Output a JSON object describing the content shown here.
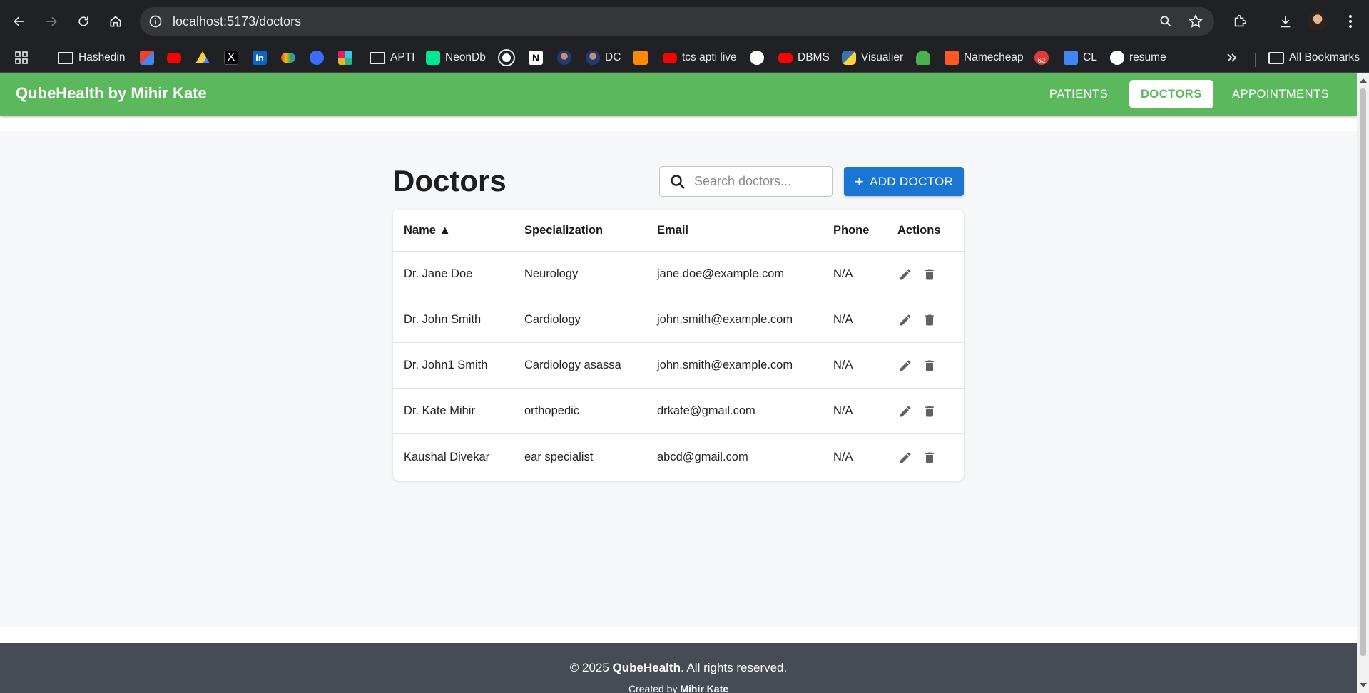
{
  "browser": {
    "url": "localhost:5173/doctors",
    "bookmarks": [
      {
        "label": "Hashedin",
        "icon": "folder-icon"
      },
      {
        "label": "",
        "icon": "gmail-icon"
      },
      {
        "label": "",
        "icon": "youtube-icon"
      },
      {
        "label": "",
        "icon": "google-drive-icon"
      },
      {
        "label": "",
        "icon": "x-icon"
      },
      {
        "label": "",
        "icon": "linkedin-icon"
      },
      {
        "label": "",
        "icon": "google-cloud-icon"
      },
      {
        "label": "",
        "icon": "kotak-icon"
      },
      {
        "label": "",
        "icon": "slack-icon"
      },
      {
        "label": "APTI",
        "icon": "folder-icon"
      },
      {
        "label": "NeonDb",
        "icon": "neon-icon"
      },
      {
        "label": "",
        "icon": "openai-icon"
      },
      {
        "label": "",
        "icon": "notion-icon"
      },
      {
        "label": "",
        "icon": "profile-icon"
      },
      {
        "label": "DC",
        "icon": "profile-icon"
      },
      {
        "label": "",
        "icon": "box-icon"
      },
      {
        "label": "tcs apti live",
        "icon": "youtube-icon"
      },
      {
        "label": "",
        "icon": "github-icon"
      },
      {
        "label": "DBMS",
        "icon": "youtube-icon"
      },
      {
        "label": "Visualier",
        "icon": "python-icon"
      },
      {
        "label": "",
        "icon": "mushroom-icon"
      },
      {
        "label": "Namecheap",
        "icon": "namecheap-icon"
      },
      {
        "label": "",
        "icon": "notification-icon"
      },
      {
        "label": "CL",
        "icon": "docs-icon"
      },
      {
        "label": "resume",
        "icon": "resume-icon"
      }
    ],
    "notification_count": "62",
    "all_bookmarks": "All Bookmarks"
  },
  "app": {
    "brand": "QubeHealth by Mihir Kate",
    "nav": {
      "patients": "PATIENTS",
      "doctors": "DOCTORS",
      "appointments": "APPOINTMENTS"
    },
    "active_tab": "doctors"
  },
  "doctors_page": {
    "title": "Doctors",
    "search_placeholder": "Search doctors...",
    "add_button": "ADD DOCTOR",
    "columns": {
      "name": "Name ▲",
      "specialization": "Specialization",
      "email": "Email",
      "phone": "Phone",
      "actions": "Actions"
    },
    "rows": [
      {
        "name": "Dr. Jane Doe",
        "specialization": "Neurology",
        "email": "jane.doe@example.com",
        "phone": "N/A"
      },
      {
        "name": "Dr. John Smith",
        "specialization": "Cardiology",
        "email": "john.smith@example.com",
        "phone": "N/A"
      },
      {
        "name": "Dr. John1 Smith",
        "specialization": "Cardiology asassa",
        "email": "john.smith@example.com",
        "phone": "N/A"
      },
      {
        "name": "Dr. Kate Mihir",
        "specialization": "orthopedic",
        "email": "drkate@gmail.com",
        "phone": "N/A"
      },
      {
        "name": "Kaushal Divekar",
        "specialization": "ear specialist",
        "email": "abcd@gmail.com",
        "phone": "N/A"
      }
    ]
  },
  "footer": {
    "copyright_prefix": "© 2025 ",
    "brand": "QubeHealth",
    "copyright_suffix": ". All rights reserved.",
    "created_prefix": "Created by ",
    "author": "Mihir Kate"
  },
  "colors": {
    "app_bar": "#5cb85c",
    "primary_button": "#1976d2",
    "footer": "#474c54"
  }
}
